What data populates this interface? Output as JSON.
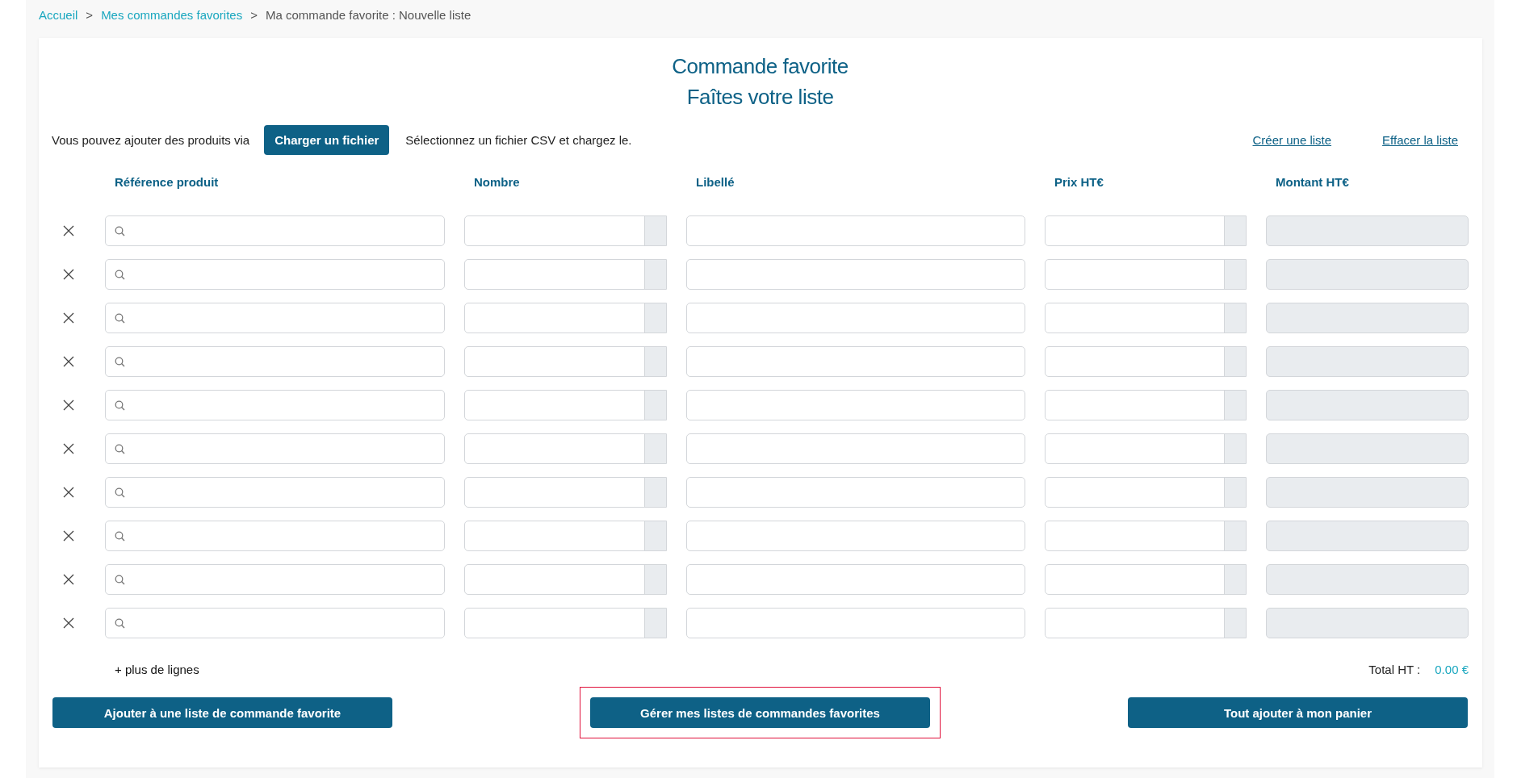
{
  "breadcrumb": [
    {
      "label": "Accueil",
      "link": true
    },
    {
      "label": "Mes commandes favorites",
      "link": true
    },
    {
      "label": "Ma commande favorite : Nouvelle liste",
      "link": false
    }
  ],
  "breadcrumb_separator": ">",
  "title": "Commande favorite",
  "subtitle": "Faîtes votre liste",
  "upload": {
    "intro": "Vous pouvez ajouter des produits via",
    "button": "Charger un fichier",
    "hint": "Sélectionnez un fichier CSV et chargez le."
  },
  "links": [
    "Créer une liste",
    "Effacer la liste"
  ],
  "table": {
    "columns": [
      "Référence produit",
      "Nombre",
      "Libellé",
      "Prix HT€",
      "Montant HT€"
    ],
    "rows": [
      {
        "kind": "product-line"
      },
      {
        "kind": "product-line"
      },
      {
        "kind": "product-line"
      },
      {
        "kind": "product-line"
      },
      {
        "kind": "product-line"
      },
      {
        "kind": "product-line"
      },
      {
        "kind": "product-line"
      },
      {
        "kind": "product-line"
      },
      {
        "kind": "product-line"
      },
      {
        "kind": "product-line"
      }
    ]
  },
  "more_lines": "+ plus de lignes",
  "total": {
    "label": "Total HT :",
    "value": "0.00 €"
  },
  "buttons": [
    {
      "label": "Ajouter à une liste de commande favorite",
      "highlighted": false
    },
    {
      "label": "Gérer mes listes de commandes favorites",
      "highlighted": true
    },
    {
      "label": "Tout ajouter à mon panier",
      "highlighted": false
    }
  ]
}
